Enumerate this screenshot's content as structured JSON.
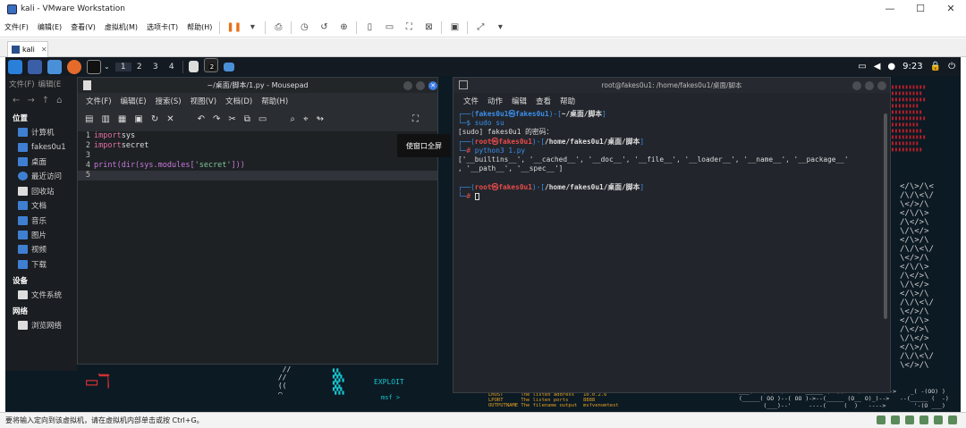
{
  "window": {
    "title": "kali - VMware Workstation"
  },
  "menubar": {
    "items": [
      "文件(F)",
      "编辑(E)",
      "查看(V)",
      "虚拟机(M)",
      "选项卡(T)",
      "帮助(H)"
    ]
  },
  "vm_tab": {
    "label": "kali"
  },
  "kali_panel": {
    "workspaces": [
      "1",
      "2",
      "3",
      "4"
    ],
    "badge": "2",
    "clock": "9:23"
  },
  "file_manager": {
    "menu": [
      "文件(F)",
      "编辑(E"
    ],
    "sections": [
      {
        "title": "位置",
        "items": [
          "计算机",
          "fakes0u1",
          "桌面",
          "最近访问",
          "回收站",
          "文档",
          "音乐",
          "图片",
          "视频",
          "下载"
        ]
      },
      {
        "title": "设备",
        "items": [
          "文件系统"
        ]
      },
      {
        "title": "网络",
        "items": [
          "浏览网络"
        ]
      }
    ]
  },
  "mousepad": {
    "title": "~/桌面/脚本/1.py - Mousepad",
    "menu": [
      "文件(F)",
      "编辑(E)",
      "搜索(S)",
      "视图(V)",
      "文档(D)",
      "帮助(H)"
    ],
    "tooltip": "使窗口全屏",
    "code": [
      {
        "n": "1",
        "kw": "import",
        "rest": " sys"
      },
      {
        "n": "2",
        "kw": "import",
        "rest": " secret"
      },
      {
        "n": "3",
        "kw": "",
        "rest": ""
      },
      {
        "n": "4",
        "kw": "",
        "rest": "print(dir(sys.modules['secret']))"
      },
      {
        "n": "5",
        "kw": "",
        "rest": ""
      }
    ]
  },
  "terminal": {
    "title": "root@fakes0u1: /home/fakes0u1/桌面/脚本",
    "menu": [
      "文件",
      "动作",
      "编辑",
      "查看",
      "帮助"
    ],
    "user1": "fakes0u1㉿fakes0u1",
    "path1": "~/桌面/脚本",
    "cmd1": "sudo su",
    "sudo_prompt": "[sudo] fakes0u1 的密码：",
    "root_user": "root㉿fakes0u1",
    "root_path": "/home/fakes0u1/桌面/脚本",
    "cmd2": "python3 1.py",
    "output1": "['__builtins__', '__cached__', '__doc__', '__file__', '__loader__', '__name__', '__package__'",
    "output2": ", '__path__', '__spec__']"
  },
  "wallpaper": {
    "exploit": "EXPLOIT",
    "msf": "msf >"
  },
  "statusbar": {
    "text": "要将输入定向到该虚拟机，请在虚拟机内部单击或按 Ctrl+G。"
  }
}
